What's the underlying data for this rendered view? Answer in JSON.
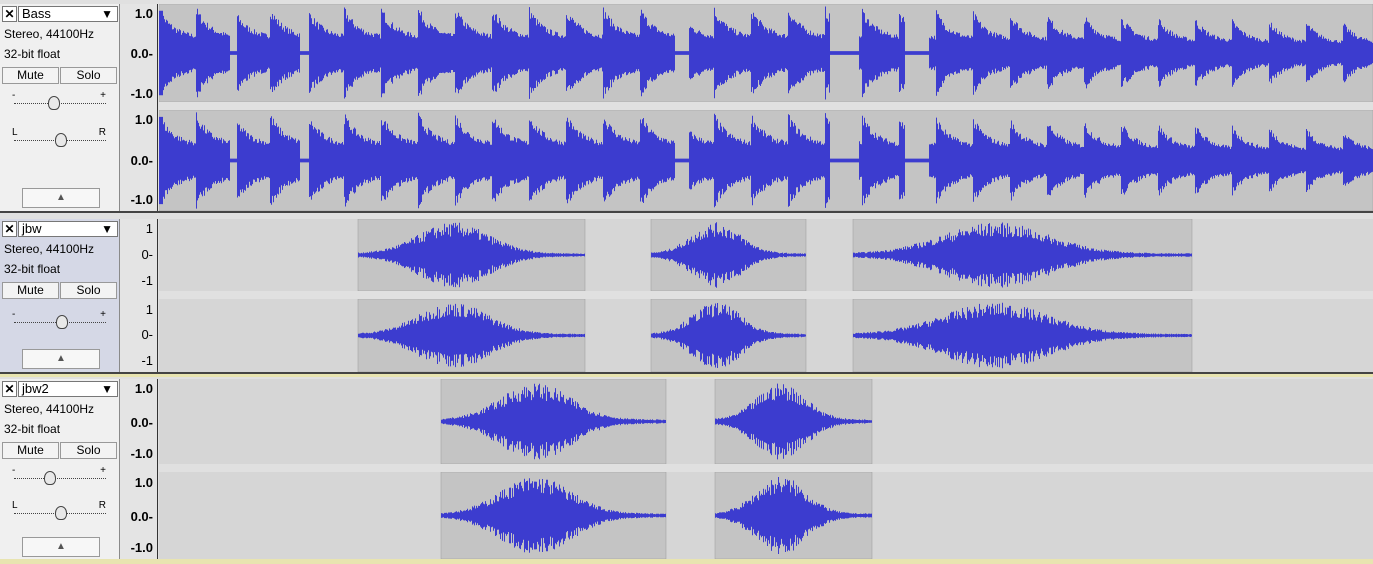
{
  "tracks": [
    {
      "name": "Bass",
      "format": "Stereo, 44100Hz",
      "depth": "32-bit float",
      "mute_label": "Mute",
      "solo_label": "Solo",
      "gain_minus": "-",
      "gain_plus": "+",
      "pan_left": "L",
      "pan_right": "R",
      "scale": [
        "1.0",
        "0.0-",
        "-1.0"
      ],
      "clips": [
        {
          "start": 0.0,
          "end": 1.0
        }
      ],
      "waveform": "dense bass notes"
    },
    {
      "name": "jbw",
      "format": "Stereo, 44100Hz",
      "depth": "32-bit float",
      "mute_label": "Mute",
      "solo_label": "Solo",
      "gain_minus": "-",
      "gain_plus": "+",
      "scale": [
        "1",
        "0-",
        "-1"
      ],
      "clips": [
        {
          "start": 0.164,
          "end": 0.351
        },
        {
          "start": 0.405,
          "end": 0.533
        },
        {
          "start": 0.572,
          "end": 0.851
        }
      ],
      "waveform": "swells"
    },
    {
      "name": "jbw2",
      "format": "Stereo, 44100Hz",
      "depth": "32-bit float",
      "mute_label": "Mute",
      "solo_label": "Solo",
      "gain_minus": "-",
      "gain_plus": "+",
      "pan_left": "L",
      "pan_right": "R",
      "scale": [
        "1.0",
        "0.0-",
        "-1.0"
      ],
      "clips": [
        {
          "start": 0.232,
          "end": 0.418
        },
        {
          "start": 0.458,
          "end": 0.587
        }
      ],
      "waveform": "swells"
    }
  ],
  "icons": {
    "close": "✕",
    "dropdown": "▼",
    "collapse": "▲"
  },
  "colors": {
    "wave": "#3c3ccf",
    "clip_bg": "#c4c4c4",
    "empty_bg": "#d6d6d6",
    "selected_panel": "#d5d8e6"
  }
}
